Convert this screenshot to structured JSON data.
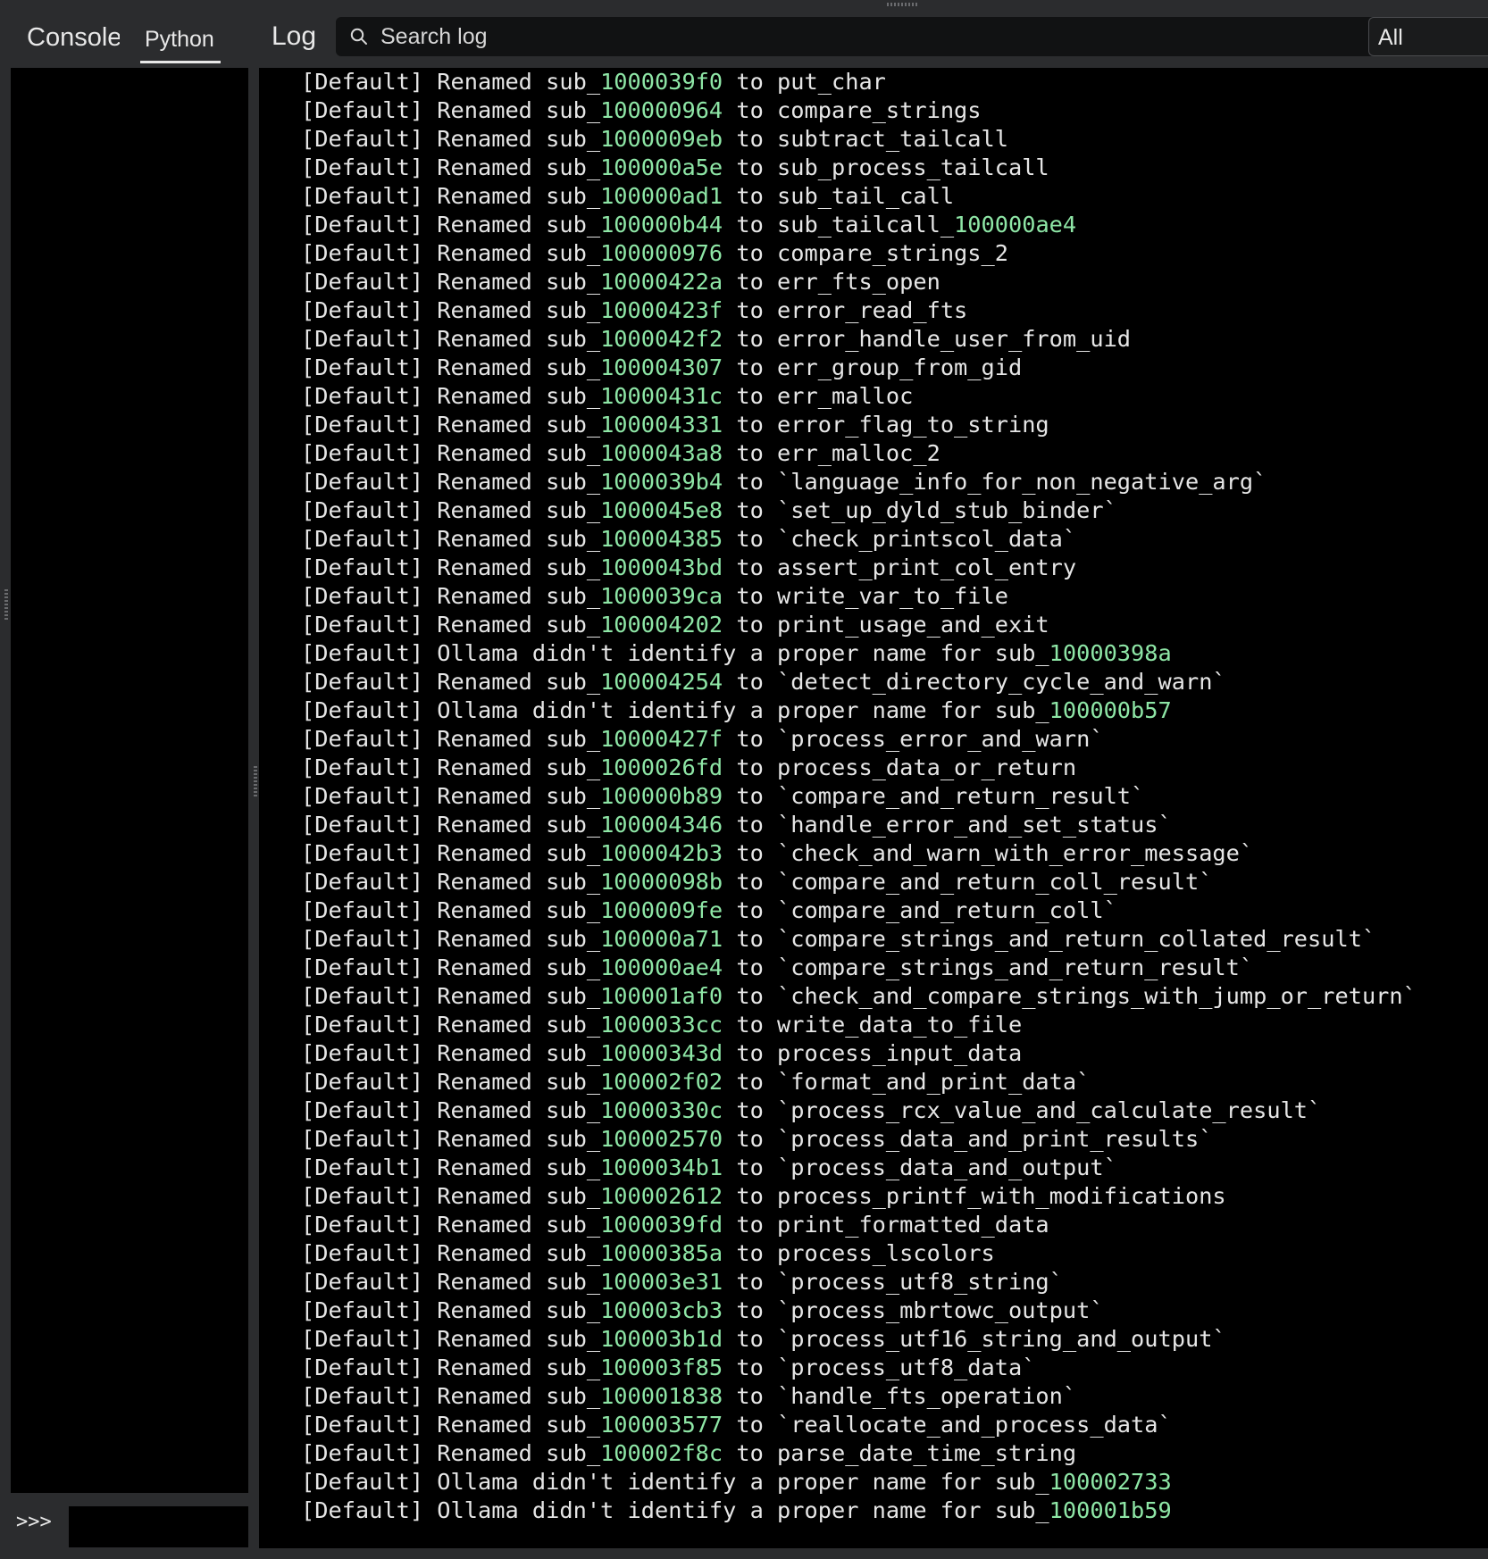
{
  "left_pane": {
    "tabs": [
      {
        "label": "Console",
        "active": false
      },
      {
        "label": "Python",
        "active": true
      }
    ],
    "prompt": ">>>",
    "input_value": ""
  },
  "log_pane": {
    "title": "Log",
    "search": {
      "placeholder": "Search log",
      "value": ""
    },
    "filter": {
      "selected": "All"
    },
    "lines": [
      {
        "pre": "[Default] Renamed sub_",
        "addr": "1000039f0",
        "post": " to put_char",
        "addr2": ""
      },
      {
        "pre": "[Default] Renamed sub_",
        "addr": "100000964",
        "post": " to compare_strings",
        "addr2": ""
      },
      {
        "pre": "[Default] Renamed sub_",
        "addr": "1000009eb",
        "post": " to subtract_tailcall",
        "addr2": ""
      },
      {
        "pre": "[Default] Renamed sub_",
        "addr": "100000a5e",
        "post": " to sub_process_tailcall",
        "addr2": ""
      },
      {
        "pre": "[Default] Renamed sub_",
        "addr": "100000ad1",
        "post": " to sub_tail_call",
        "addr2": ""
      },
      {
        "pre": "[Default] Renamed sub_",
        "addr": "100000b44",
        "post": " to sub_tailcall_",
        "addr2": "100000ae4"
      },
      {
        "pre": "[Default] Renamed sub_",
        "addr": "100000976",
        "post": " to compare_strings_2",
        "addr2": ""
      },
      {
        "pre": "[Default] Renamed sub_",
        "addr": "10000422a",
        "post": " to err_fts_open",
        "addr2": ""
      },
      {
        "pre": "[Default] Renamed sub_",
        "addr": "10000423f",
        "post": " to error_read_fts",
        "addr2": ""
      },
      {
        "pre": "[Default] Renamed sub_",
        "addr": "1000042f2",
        "post": " to error_handle_user_from_uid",
        "addr2": ""
      },
      {
        "pre": "[Default] Renamed sub_",
        "addr": "100004307",
        "post": " to err_group_from_gid",
        "addr2": ""
      },
      {
        "pre": "[Default] Renamed sub_",
        "addr": "10000431c",
        "post": " to err_malloc",
        "addr2": ""
      },
      {
        "pre": "[Default] Renamed sub_",
        "addr": "100004331",
        "post": " to error_flag_to_string",
        "addr2": ""
      },
      {
        "pre": "[Default] Renamed sub_",
        "addr": "1000043a8",
        "post": " to err_malloc_2",
        "addr2": ""
      },
      {
        "pre": "[Default] Renamed sub_",
        "addr": "1000039b4",
        "post": " to `language_info_for_non_negative_arg`",
        "addr2": ""
      },
      {
        "pre": "[Default] Renamed sub_",
        "addr": "1000045e8",
        "post": " to `set_up_dyld_stub_binder`",
        "addr2": ""
      },
      {
        "pre": "[Default] Renamed sub_",
        "addr": "100004385",
        "post": " to `check_printscol_data`",
        "addr2": ""
      },
      {
        "pre": "[Default] Renamed sub_",
        "addr": "1000043bd",
        "post": " to assert_print_col_entry",
        "addr2": ""
      },
      {
        "pre": "[Default] Renamed sub_",
        "addr": "1000039ca",
        "post": " to write_var_to_file",
        "addr2": ""
      },
      {
        "pre": "[Default] Renamed sub_",
        "addr": "100004202",
        "post": " to print_usage_and_exit",
        "addr2": ""
      },
      {
        "pre": "[Default] Ollama didn't identify a proper name for sub_",
        "addr": "10000398a",
        "post": "",
        "addr2": ""
      },
      {
        "pre": "[Default] Renamed sub_",
        "addr": "100004254",
        "post": " to `detect_directory_cycle_and_warn`",
        "addr2": ""
      },
      {
        "pre": "[Default] Ollama didn't identify a proper name for sub_",
        "addr": "100000b57",
        "post": "",
        "addr2": ""
      },
      {
        "pre": "[Default] Renamed sub_",
        "addr": "10000427f",
        "post": " to `process_error_and_warn`",
        "addr2": ""
      },
      {
        "pre": "[Default] Renamed sub_",
        "addr": "1000026fd",
        "post": " to process_data_or_return",
        "addr2": ""
      },
      {
        "pre": "[Default] Renamed sub_",
        "addr": "100000b89",
        "post": " to `compare_and_return_result`",
        "addr2": ""
      },
      {
        "pre": "[Default] Renamed sub_",
        "addr": "100004346",
        "post": " to `handle_error_and_set_status`",
        "addr2": ""
      },
      {
        "pre": "[Default] Renamed sub_",
        "addr": "1000042b3",
        "post": " to `check_and_warn_with_error_message`",
        "addr2": ""
      },
      {
        "pre": "[Default] Renamed sub_",
        "addr": "10000098b",
        "post": " to `compare_and_return_coll_result`",
        "addr2": ""
      },
      {
        "pre": "[Default] Renamed sub_",
        "addr": "1000009fe",
        "post": " to `compare_and_return_coll`",
        "addr2": ""
      },
      {
        "pre": "[Default] Renamed sub_",
        "addr": "100000a71",
        "post": " to `compare_strings_and_return_collated_result`",
        "addr2": ""
      },
      {
        "pre": "[Default] Renamed sub_",
        "addr": "100000ae4",
        "post": " to `compare_strings_and_return_result`",
        "addr2": ""
      },
      {
        "pre": "[Default] Renamed sub_",
        "addr": "100001af0",
        "post": " to `check_and_compare_strings_with_jump_or_return`",
        "addr2": ""
      },
      {
        "pre": "[Default] Renamed sub_",
        "addr": "1000033cc",
        "post": " to write_data_to_file",
        "addr2": ""
      },
      {
        "pre": "[Default] Renamed sub_",
        "addr": "10000343d",
        "post": " to process_input_data",
        "addr2": ""
      },
      {
        "pre": "[Default] Renamed sub_",
        "addr": "100002f02",
        "post": " to `format_and_print_data`",
        "addr2": ""
      },
      {
        "pre": "[Default] Renamed sub_",
        "addr": "10000330c",
        "post": " to `process_rcx_value_and_calculate_result`",
        "addr2": ""
      },
      {
        "pre": "[Default] Renamed sub_",
        "addr": "100002570",
        "post": " to `process_data_and_print_results`",
        "addr2": ""
      },
      {
        "pre": "[Default] Renamed sub_",
        "addr": "1000034b1",
        "post": " to `process_data_and_output`",
        "addr2": ""
      },
      {
        "pre": "[Default] Renamed sub_",
        "addr": "100002612",
        "post": " to process_printf_with_modifications",
        "addr2": ""
      },
      {
        "pre": "[Default] Renamed sub_",
        "addr": "1000039fd",
        "post": " to print_formatted_data",
        "addr2": ""
      },
      {
        "pre": "[Default] Renamed sub_",
        "addr": "10000385a",
        "post": " to process_lscolors",
        "addr2": ""
      },
      {
        "pre": "[Default] Renamed sub_",
        "addr": "100003e31",
        "post": " to `process_utf8_string`",
        "addr2": ""
      },
      {
        "pre": "[Default] Renamed sub_",
        "addr": "100003cb3",
        "post": " to `process_mbrtowc_output`",
        "addr2": ""
      },
      {
        "pre": "[Default] Renamed sub_",
        "addr": "100003b1d",
        "post": " to `process_utf16_string_and_output`",
        "addr2": ""
      },
      {
        "pre": "[Default] Renamed sub_",
        "addr": "100003f85",
        "post": " to `process_utf8_data`",
        "addr2": ""
      },
      {
        "pre": "[Default] Renamed sub_",
        "addr": "100001838",
        "post": " to `handle_fts_operation`",
        "addr2": ""
      },
      {
        "pre": "[Default] Renamed sub_",
        "addr": "100003577",
        "post": " to `reallocate_and_process_data`",
        "addr2": ""
      },
      {
        "pre": "[Default] Renamed sub_",
        "addr": "100002f8c",
        "post": " to parse_date_time_string",
        "addr2": ""
      },
      {
        "pre": "[Default] Ollama didn't identify a proper name for sub_",
        "addr": "100002733",
        "post": "",
        "addr2": ""
      },
      {
        "pre": "[Default] Ollama didn't identify a proper name for sub_",
        "addr": "100001b59",
        "post": "",
        "addr2": ""
      }
    ]
  },
  "colors": {
    "background": "#2b2c2e",
    "log_background": "#000000",
    "text": "#e6e6e6",
    "address_highlight": "#8ee6a6"
  },
  "icons": {
    "search": "search-icon"
  }
}
